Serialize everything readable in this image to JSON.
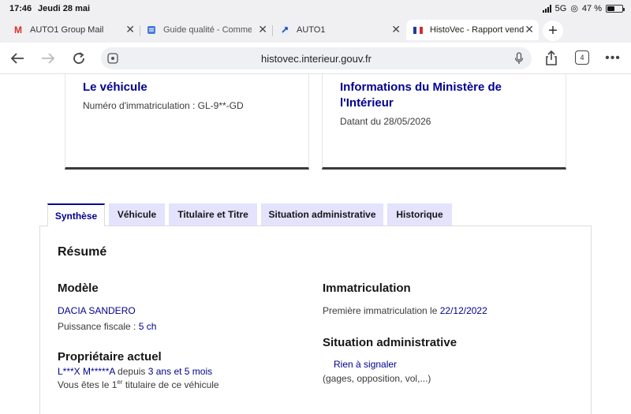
{
  "status_bar": {
    "time": "17:46",
    "date": "Jeudi 28 mai",
    "network": "5G",
    "battery": "47 %"
  },
  "browser_tabs": [
    {
      "title": "AUTO1 Group Mail",
      "favicon": "M"
    },
    {
      "title": "Guide qualité - Commen",
      "favicon": "doc-icon"
    },
    {
      "title": "AUTO1",
      "favicon": "auto1-icon"
    },
    {
      "title": "HistoVec - Rapport vend",
      "favicon": "flag-icon",
      "active": true
    }
  ],
  "toolbar": {
    "url": "histovec.interieur.gouv.fr",
    "tab_count": "4"
  },
  "cards": {
    "vehicle": {
      "title": "Le véhicule",
      "plate_label": "Numéro d'immatriculation : GL-9**-GD"
    },
    "ministry": {
      "title_line1": "Informations du Ministère de",
      "title_line2": "l'Intérieur",
      "date_label": "Datant du 28/05/2026"
    }
  },
  "page_tabs": [
    "Synthèse",
    "Véhicule",
    "Titulaire et Titre",
    "Situation administrative",
    "Historique"
  ],
  "summary": {
    "heading": "Résumé",
    "model_heading": "Modèle",
    "model": "DACIA SANDERO",
    "fiscal_label": "Puissance fiscale : ",
    "fiscal_value": "5 ch",
    "owner_heading": "Propriétaire actuel",
    "owner_name": "L***X M*****A",
    "owner_since_label": " depuis ",
    "owner_since": "3 ans et 5 mois",
    "owner_rank_prefix": "Vous êtes le 1",
    "owner_rank_sup": "er",
    "owner_rank_suffix": " titulaire de ce véhicule",
    "registration_heading": "Immatriculation",
    "first_reg_label": "Première immatriculation le ",
    "first_reg_date": "22/12/2022",
    "admin_heading": "Situation administrative",
    "admin_status": "Rien à signaler",
    "admin_note": "(gages, opposition, vol,...)"
  },
  "colors": {
    "accent": "#000091",
    "tab_bg": "#e3e3fd",
    "card_border": "#3a3a3a"
  }
}
